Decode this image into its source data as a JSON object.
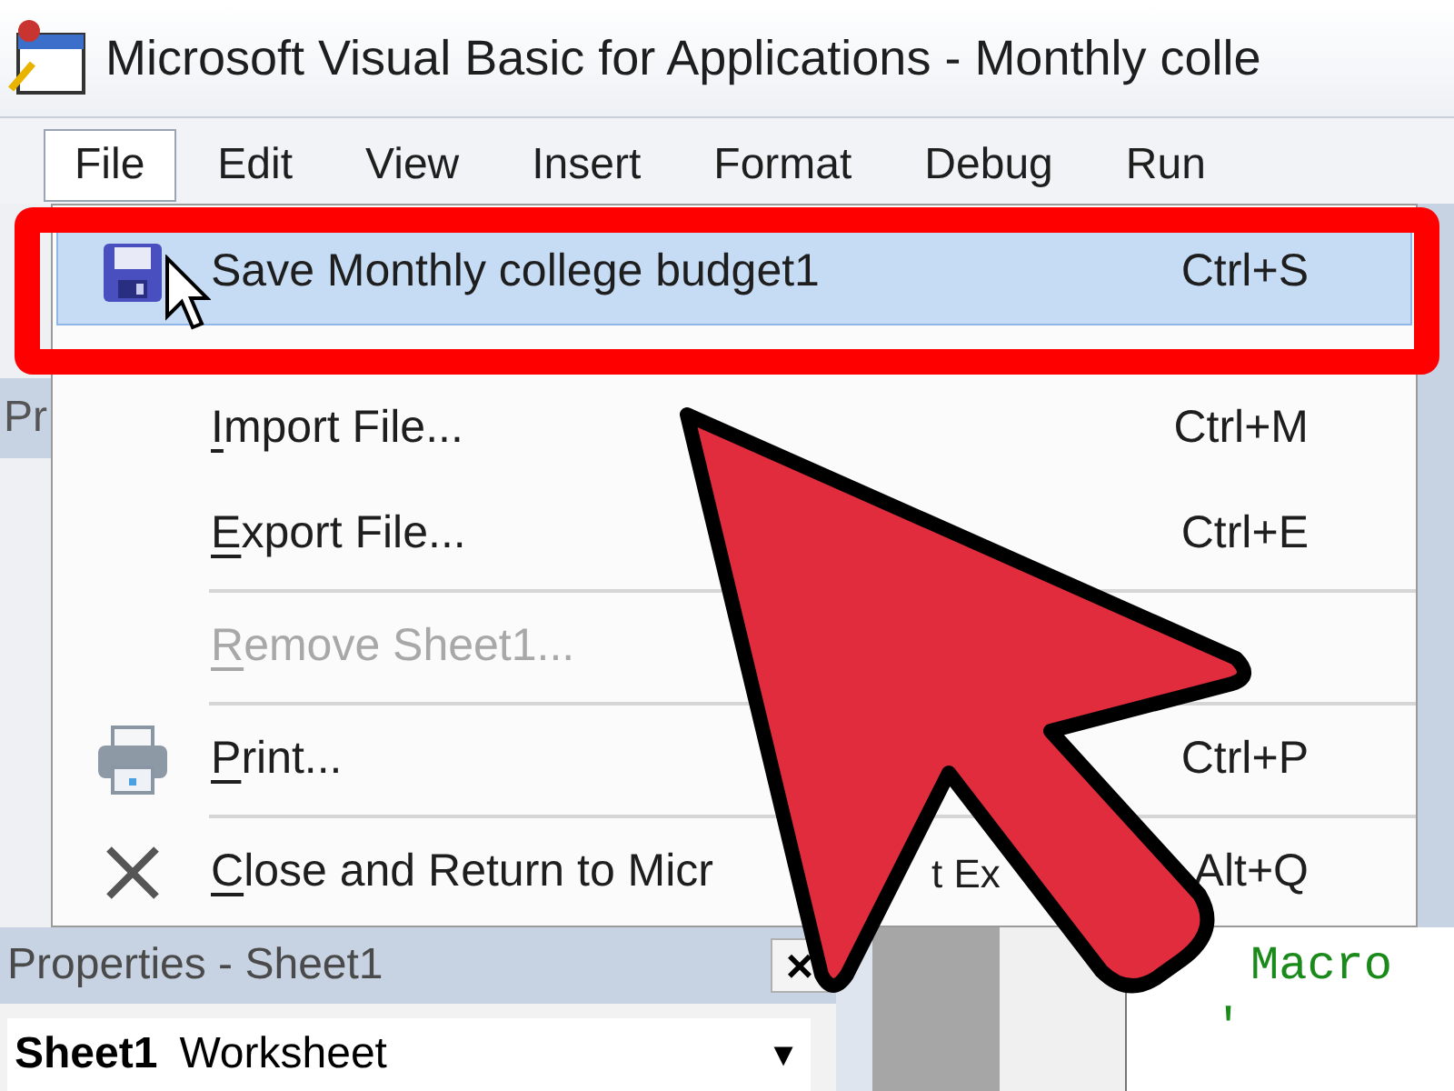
{
  "window": {
    "title": "Microsoft Visual Basic for Applications - Monthly colle"
  },
  "menu_bar": [
    {
      "label": "File",
      "selected": true
    },
    {
      "label": "Edit",
      "selected": false
    },
    {
      "label": "View",
      "selected": false
    },
    {
      "label": "Insert",
      "selected": false
    },
    {
      "label": "Format",
      "selected": false
    },
    {
      "label": "Debug",
      "selected": false
    },
    {
      "label": "Run",
      "selected": false
    }
  ],
  "file_menu": [
    {
      "kind": "save",
      "label": "Save Monthly college budget1",
      "shortcut": "Ctrl+S",
      "selected": true,
      "disabled": false,
      "separator_before": false
    },
    {
      "kind": "plain",
      "label": "Import File...",
      "shortcut": "Ctrl+M",
      "selected": false,
      "disabled": false,
      "separator_before": false
    },
    {
      "kind": "plain",
      "label": "Export File...",
      "shortcut": "Ctrl+E",
      "selected": false,
      "disabled": false,
      "separator_before": false
    },
    {
      "kind": "plain",
      "label": "Remove Sheet1...",
      "selected": false,
      "disabled": true,
      "separator_before": true
    },
    {
      "kind": "print",
      "label": "Print...",
      "shortcut": "Ctrl+P",
      "selected": false,
      "disabled": false,
      "separator_before": true
    },
    {
      "kind": "close",
      "label": "Close and Return to Micr",
      "label_tail": "t Ex",
      "shortcut": "Alt+Q",
      "selected": false,
      "disabled": false,
      "separator_before": true
    }
  ],
  "project_panel": {
    "title": "Pr"
  },
  "properties_panel": {
    "title": "Properties - Sheet1",
    "close": "×",
    "object": {
      "name": "Sheet1",
      "type": "Worksheet"
    },
    "dropdown_arrow": "▼"
  },
  "code_window": {
    "lines": [
      "Macro",
      "'"
    ]
  }
}
